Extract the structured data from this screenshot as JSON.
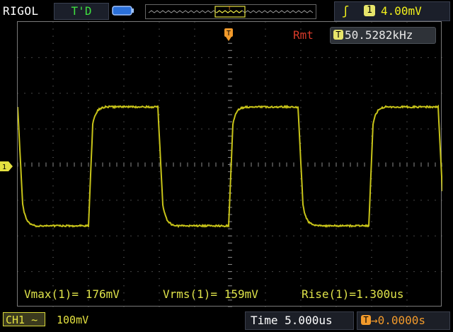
{
  "header": {
    "brand": "RIGOL",
    "run_status": "T'D",
    "trigger_channel_badge": "1",
    "trigger_level": "4.00mV",
    "icons": [
      "battery-icon",
      "rising-edge-icon"
    ]
  },
  "display": {
    "trigger_marker": "T",
    "rmt_label": "Rmt",
    "frequency_icon": "T",
    "frequency": "50.5282kHz",
    "channel_marker": "1"
  },
  "measurements": [
    {
      "label": "Vmax(1)= 176mV"
    },
    {
      "label": "Vrms(1)= 159mV"
    },
    {
      "label": "Rise(1)=1.300us"
    }
  ],
  "footer": {
    "channel_label": "CH1",
    "channel_scale": "100mV",
    "time_label": "Time 5.000us",
    "offset_icon": "T",
    "offset_value": "→0.0000s"
  },
  "colors": {
    "trace": "#c8c419",
    "grid": "#8a8a8a",
    "channel": "#e4e140",
    "rmt": "#d83a2a",
    "offset": "#f29a2b"
  }
}
